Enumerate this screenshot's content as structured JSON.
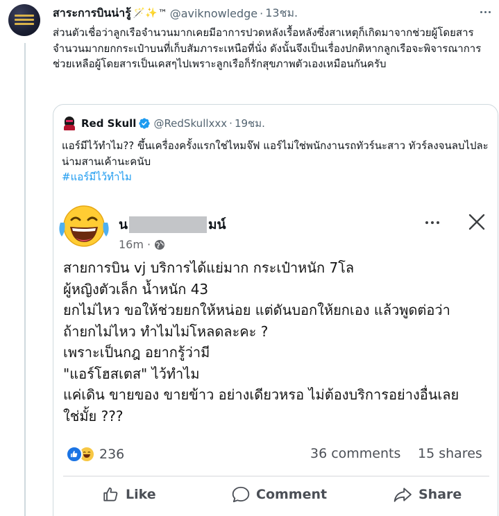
{
  "tweet": {
    "author_name": "สาระการบินน่ารู้",
    "name_emoji": "🪄✨",
    "name_tm": "™",
    "handle": "@aviknowledge",
    "separator": "·",
    "time": "13ชม.",
    "text": "ส่วนตัวเชื่อว่าลูกเรือจำนวนมากเคยมีอาการปวดหลังเรื้อหลังซึ่งสาเหตุก็เกิดมาจากช่วยผู้โดยสารจำนวนมากยกกระเป๋าบนที่เก็บสัมภาระเหนือที่นั่ง ดังนั้นจึงเป็นเรื่องปกติหากลูกเรือจะพิจารณาการช่วยเหลือผู้โดยสารเป็นเคสๆไปเพราะลูกเรือก็รักสุขภาพตัวเองเหมือนกันครับ"
  },
  "quote": {
    "author_name": "Red Skull",
    "handle": "@RedSkullxxx",
    "separator": "·",
    "time": "19ชม.",
    "text_line1": "แอร์มีไว้ทำไม?? ขึ้นเครื่องครั้งแรกใช่ไหมจ๊ฟ แอร์ไม่ใช่พนักงานรถทัวร์นะสาว ทัวร์ลงจนลบไปละ น่ามสานเค้านะคนับ",
    "hashtag": "#แอร์มีไว้ทำไม"
  },
  "fb_post": {
    "name_prefix": "น",
    "name_suffix": "มน์",
    "time": "16m",
    "separator": "·",
    "lines": [
      "สายการบิน vj บริการได้แย่มาก กระเป๋าหนัก 7โล",
      "ผู้หญิงตัวเล็ก น้ำหนัก 43",
      "ยกไม่ไหว ขอให้ช่วยยกให้หน่อย แต่ดันบอกให้ยกเอง แล้วพูดต่อว่า",
      "ถ้ายกไม่ไหว ทำไมไม่โหลดละคะ ?",
      "เพราะเป็นกฎ อยากรู้ว่ามี",
      "\"แอร์โฮสเตส\" ไว้ทำไม",
      "แค่เดิน ขายของ ขายข้าว อย่างเดียวหรอ ไม่ต้องบริการอย่างอื่นเลย",
      "ใช่มั้ย ???"
    ],
    "reaction_count": "236",
    "comments": "36 comments",
    "shares": "15 shares",
    "like_label": "Like",
    "comment_label": "Comment",
    "share_label": "Share"
  },
  "icons": {
    "more": "more-horizontal-icon",
    "verified": "verified-badge-icon",
    "globe": "globe-icon",
    "close": "close-icon",
    "like": "thumbs-up-icon",
    "comment": "comment-bubble-icon",
    "share": "share-arrow-icon"
  },
  "colors": {
    "accent": "#1d9bf0",
    "fb_blue": "#1b74e4",
    "haha_yellow": "#f7c744",
    "muted_text": "#536471"
  }
}
